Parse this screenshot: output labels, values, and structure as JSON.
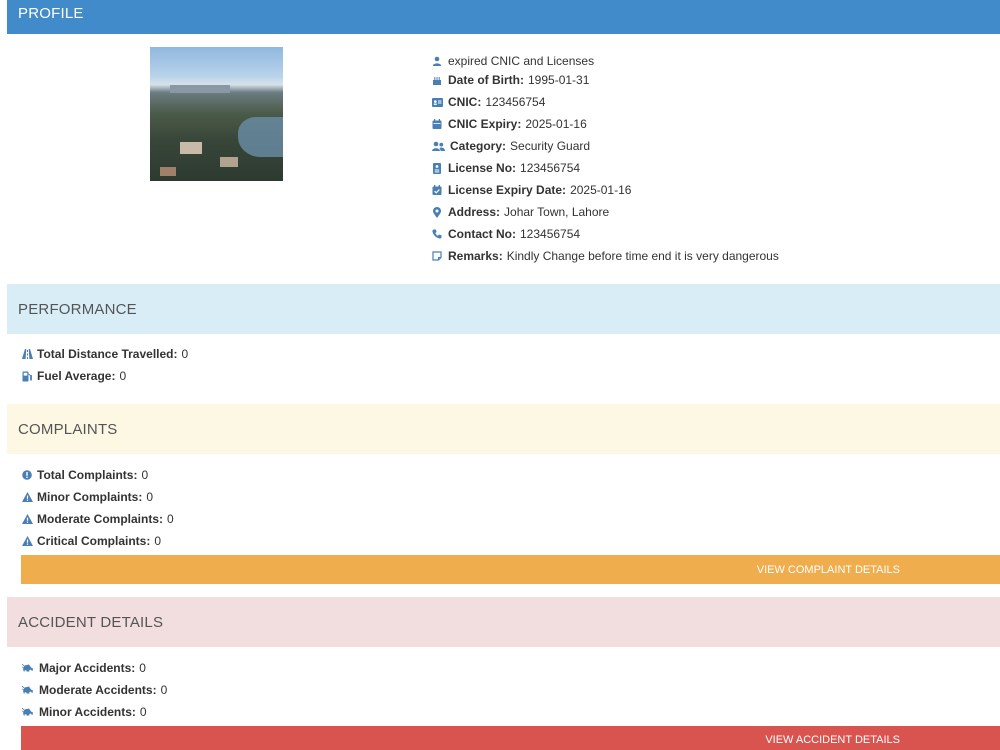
{
  "profile": {
    "header": "PROFILE",
    "photo_alt": "",
    "status_text": "expired CNIC and Licenses",
    "fields": [
      {
        "label": "Date of Birth:",
        "value": "1995-01-31"
      },
      {
        "label": "CNIC:",
        "value": "123456754"
      },
      {
        "label": "CNIC Expiry:",
        "value": "2025-01-16"
      },
      {
        "label": "Category:",
        "value": "Security Guard"
      },
      {
        "label": "License No:",
        "value": "123456754"
      },
      {
        "label": "License Expiry Date:",
        "value": "2025-01-16"
      },
      {
        "label": "Address:",
        "value": "Johar Town, Lahore"
      },
      {
        "label": "Contact No:",
        "value": "123456754"
      },
      {
        "label": "Remarks:",
        "value": "Kindly Change before time end it is very dangerous"
      }
    ]
  },
  "performance": {
    "header": "PERFORMANCE",
    "items": [
      {
        "label": "Total Distance Travelled:",
        "value": "0"
      },
      {
        "label": "Fuel Average:",
        "value": "0"
      }
    ]
  },
  "complaints": {
    "header": "COMPLAINTS",
    "items": [
      {
        "label": "Total Complaints:",
        "value": "0"
      },
      {
        "label": "Minor Complaints:",
        "value": "0"
      },
      {
        "label": "Moderate Complaints:",
        "value": "0"
      },
      {
        "label": "Critical Complaints:",
        "value": "0"
      }
    ],
    "button_label": "VIEW COMPLAINT DETAILS"
  },
  "accidents": {
    "header": "ACCIDENT DETAILS",
    "items": [
      {
        "label": "Major Accidents:",
        "value": "0"
      },
      {
        "label": "Moderate Accidents:",
        "value": "0"
      },
      {
        "label": "Minor Accidents:",
        "value": "0"
      }
    ],
    "button_label": "VIEW ACCIDENT DETAILS"
  },
  "colors": {
    "primary": "#428bca",
    "info_bg": "#d9edf7",
    "warning_bg": "#fcf8e3",
    "danger_bg": "#f2dede",
    "warning_btn": "#f0ad4e",
    "danger_btn": "#d9534f",
    "icon": "#4a7fb5"
  }
}
